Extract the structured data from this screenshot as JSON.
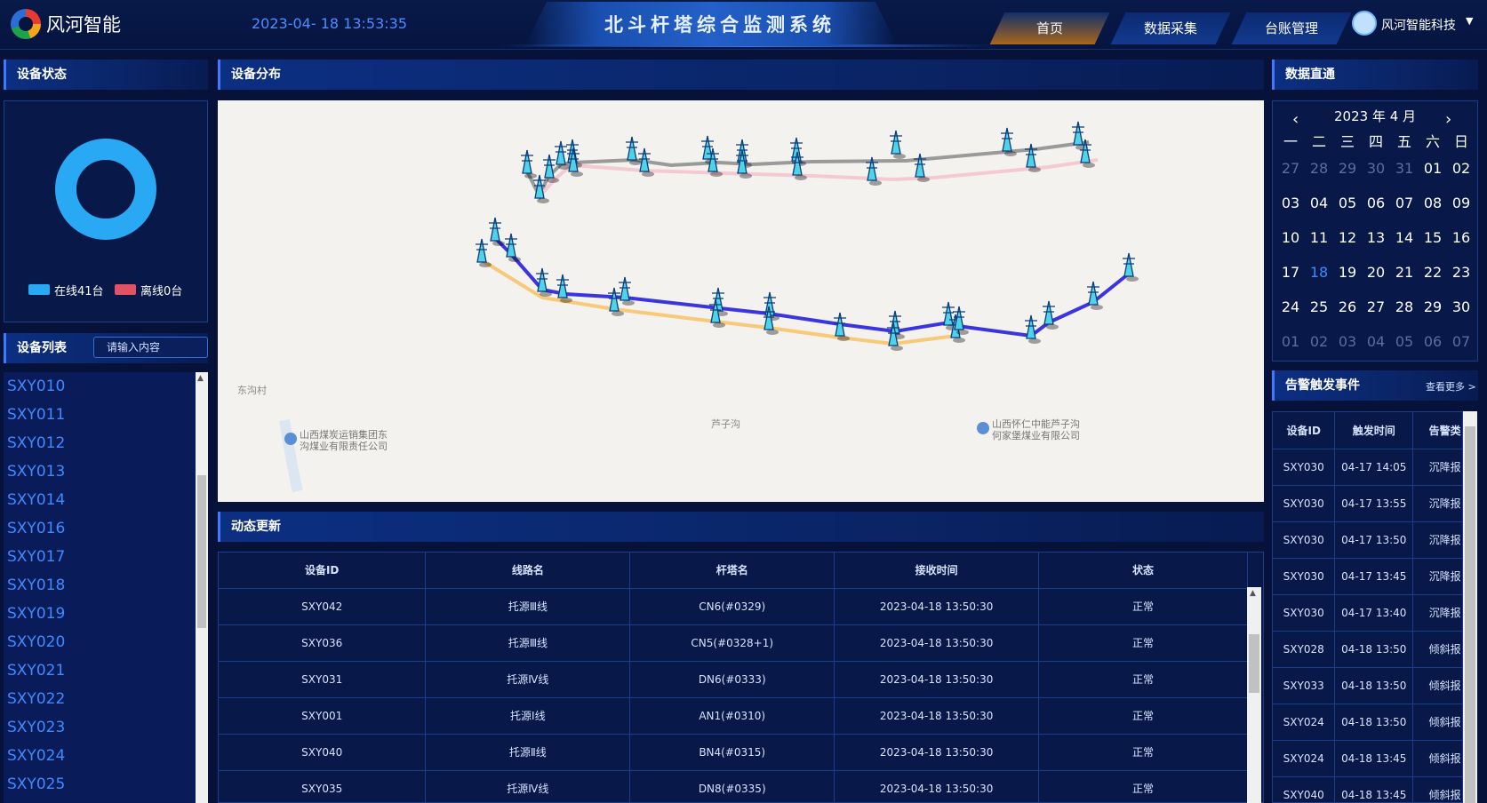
{
  "header": {
    "brand": "风河智能",
    "datetime": "2023-04- 18 13:53:35",
    "title": "北斗杆塔综合监测系统",
    "nav": [
      {
        "label": "首页",
        "active": true
      },
      {
        "label": "数据采集",
        "active": false
      },
      {
        "label": "台账管理",
        "active": false
      }
    ],
    "user": "风河智能科技"
  },
  "device_status": {
    "title": "设备状态",
    "online_label": "在线41台",
    "offline_label": "离线0台",
    "online": 41,
    "offline": 0,
    "colors": {
      "online": "#29a8f4",
      "offline": "#e05264"
    }
  },
  "device_list": {
    "title": "设备列表",
    "search_placeholder": "请输入内容",
    "items": [
      "SXY010",
      "SXY011",
      "SXY012",
      "SXY013",
      "SXY014",
      "SXY016",
      "SXY017",
      "SXY018",
      "SXY019",
      "SXY020",
      "SXY021",
      "SXY022",
      "SXY023",
      "SXY024",
      "SXY025"
    ]
  },
  "map": {
    "title": "设备分布",
    "place_labels": [
      "东沟村",
      "芦子沟"
    ],
    "poi": [
      {
        "line1": "山西煤炭运销集团东",
        "line2": "沟煤业有限责任公司"
      },
      {
        "line1": "山西怀仁中能芦子沟",
        "line2": "何家堡煤业有限公司"
      }
    ],
    "line_colors": {
      "gray": "#9a9a9a",
      "pink": "#f5c9d2",
      "blue": "#3a35e0",
      "yellow": "#f7c978"
    }
  },
  "dynamic": {
    "title": "动态更新",
    "columns": [
      "设备ID",
      "线路名",
      "杆塔名",
      "接收时间",
      "状态"
    ],
    "rows": [
      [
        "SXY042",
        "托源Ⅲ线",
        "CN6(#0329)",
        "2023-04-18 13:50:30",
        "正常"
      ],
      [
        "SXY036",
        "托源Ⅲ线",
        "CN5(#0328+1)",
        "2023-04-18 13:50:30",
        "正常"
      ],
      [
        "SXY031",
        "托源Ⅳ线",
        "DN6(#0333)",
        "2023-04-18 13:50:30",
        "正常"
      ],
      [
        "SXY001",
        "托源Ⅰ线",
        "AN1(#0310)",
        "2023-04-18 13:50:30",
        "正常"
      ],
      [
        "SXY040",
        "托源Ⅱ线",
        "BN4(#0315)",
        "2023-04-18 13:50:30",
        "正常"
      ],
      [
        "SXY035",
        "托源Ⅳ线",
        "DN8(#0335)",
        "2023-04-18 13:50:30",
        "正常"
      ]
    ]
  },
  "calendar": {
    "title": "数据直通",
    "month_label": "2023 年 4 月",
    "weekdays": [
      "一",
      "二",
      "三",
      "四",
      "五",
      "六",
      "日"
    ],
    "weeks": [
      [
        "27",
        "28",
        "29",
        "30",
        "31",
        "01",
        "02"
      ],
      [
        "03",
        "04",
        "05",
        "06",
        "07",
        "08",
        "09"
      ],
      [
        "10",
        "11",
        "12",
        "13",
        "14",
        "15",
        "16"
      ],
      [
        "17",
        "18",
        "19",
        "20",
        "21",
        "22",
        "23"
      ],
      [
        "24",
        "25",
        "26",
        "27",
        "28",
        "29",
        "30"
      ],
      [
        "01",
        "02",
        "03",
        "04",
        "05",
        "06",
        "07"
      ]
    ],
    "today": "18"
  },
  "alarm": {
    "title": "告警触发事件",
    "more": "查看更多 >",
    "columns": [
      "设备ID",
      "触发时间",
      "告警类"
    ],
    "rows": [
      [
        "SXY030",
        "04-17 14:05",
        "沉降报"
      ],
      [
        "SXY030",
        "04-17 13:55",
        "沉降报"
      ],
      [
        "SXY030",
        "04-17 13:50",
        "沉降报"
      ],
      [
        "SXY030",
        "04-17 13:45",
        "沉降报"
      ],
      [
        "SXY030",
        "04-17 13:40",
        "沉降报"
      ],
      [
        "SXY028",
        "04-18 13:50",
        "倾斜报"
      ],
      [
        "SXY033",
        "04-18 13:50",
        "倾斜报"
      ],
      [
        "SXY024",
        "04-18 13:50",
        "倾斜报"
      ],
      [
        "SXY024",
        "04-18 13:45",
        "倾斜报"
      ],
      [
        "SXY040",
        "04-18 13:45",
        "倾斜报"
      ]
    ]
  }
}
